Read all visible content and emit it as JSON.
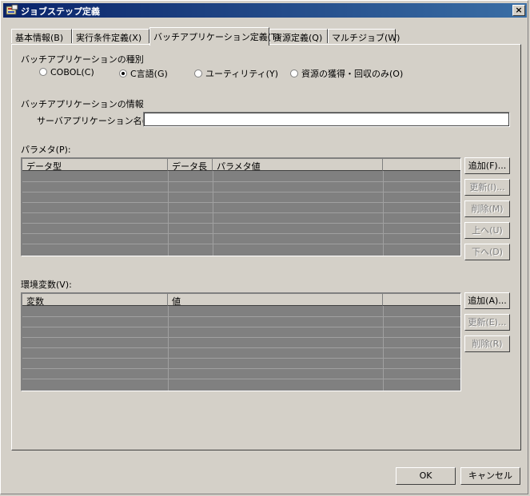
{
  "window": {
    "title": "ジョブステップ定義",
    "close_label": "×"
  },
  "tabs": [
    {
      "label": "基本情報(B)"
    },
    {
      "label": "実行条件定義(X)"
    },
    {
      "label": "バッチアプリケーション定義(T)"
    },
    {
      "label": "資源定義(Q)"
    },
    {
      "label": "マルチジョブ(W)"
    }
  ],
  "app_type": {
    "label": "バッチアプリケーションの種別",
    "options": [
      {
        "label": "COBOL(C)",
        "selected": false
      },
      {
        "label": "C言語(G)",
        "selected": true
      },
      {
        "label": "ユーティリティ(Y)",
        "selected": false
      },
      {
        "label": "資源の獲得・回収のみ(O)",
        "selected": false
      }
    ]
  },
  "app_info": {
    "label": "バッチアプリケーションの情報",
    "server_app_label": "サーバアプリケーション名(S):",
    "server_app_value": ""
  },
  "params": {
    "label": "パラメタ(P):",
    "columns": [
      "データ型",
      "データ長",
      "パラメタ値",
      ""
    ],
    "buttons": [
      {
        "label": "追加(F)...",
        "enabled": true
      },
      {
        "label": "更新(I)...",
        "enabled": false
      },
      {
        "label": "削除(M)",
        "enabled": false
      },
      {
        "label": "上へ(U)",
        "enabled": false
      },
      {
        "label": "下へ(D)",
        "enabled": false
      }
    ]
  },
  "env": {
    "label": "環境変数(V):",
    "columns": [
      "変数",
      "値",
      ""
    ],
    "buttons": [
      {
        "label": "追加(A)...",
        "enabled": true
      },
      {
        "label": "更新(E)...",
        "enabled": false
      },
      {
        "label": "削除(R)",
        "enabled": false
      }
    ]
  },
  "footer": {
    "ok_label": "OK",
    "cancel_label": "キャンセル"
  }
}
